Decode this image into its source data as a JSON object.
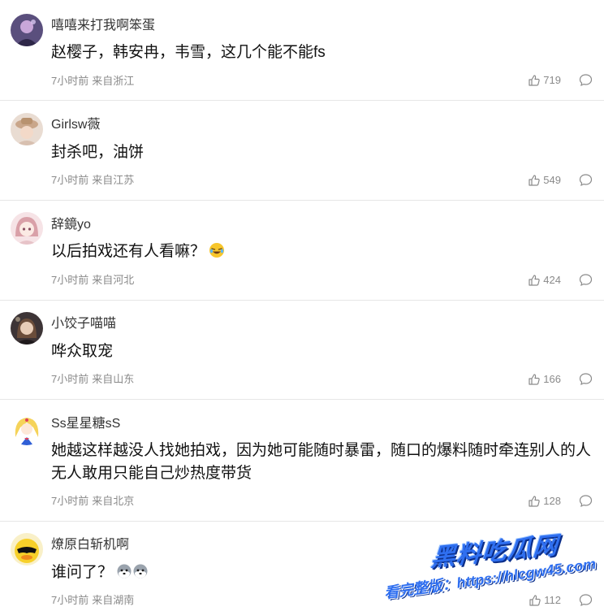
{
  "comments": [
    {
      "name": "嘻嘻来打我啊笨蛋",
      "text": "赵樱子，韩安冉，韦雪，这几个能不能fs",
      "time": "7小时前",
      "location": "来自浙江",
      "likes": "719",
      "avatar": "purple-portrait"
    },
    {
      "name": "Girlsw薇",
      "text": "封杀吧，油饼",
      "time": "7小时前",
      "location": "来自江苏",
      "likes": "549",
      "avatar": "hat-portrait"
    },
    {
      "name": "辞鏡yo",
      "text": "以后拍戏还有人看嘛？",
      "time": "7小时前",
      "location": "来自河北",
      "likes": "424",
      "avatar": "anime-girl",
      "emoji": "laughing-tears-emoji"
    },
    {
      "name": "小饺子喵喵",
      "text": "哗众取宠",
      "time": "7小时前",
      "location": "来自山东",
      "likes": "166",
      "avatar": "dark-portrait"
    },
    {
      "name": "Ss星星糖sS",
      "text": "她越这样越没人找她拍戏，因为她可能随时暴雷，随口的爆料随时牵连别人的人无人敢用只能自己炒热度带货",
      "time": "7小时前",
      "location": "来自北京",
      "likes": "128",
      "avatar": "sailor-moon"
    },
    {
      "name": "燎原白斩机啊",
      "text": "谁问了？",
      "time": "7小时前",
      "location": "来自湖南",
      "likes": "112",
      "avatar": "duck-sunglasses",
      "emoji": "husky-emoji-pair"
    }
  ],
  "watermark": {
    "title": "黑料吃瓜网",
    "url": "看完整版：https://hlcgw45.com"
  }
}
